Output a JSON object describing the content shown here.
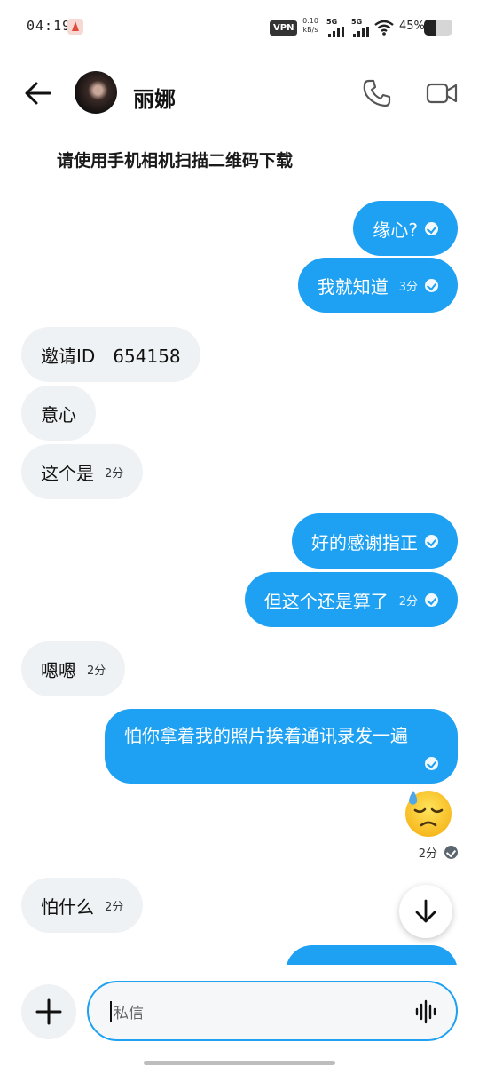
{
  "status_bar": {
    "time": "04:19",
    "vpn": "VPN",
    "speed_value": "0.10",
    "speed_unit": "kB/s",
    "signal1": "5G",
    "signal2": "5G",
    "battery": "45%"
  },
  "header": {
    "contact_name": "丽娜"
  },
  "banner": "请使用手机相机扫描二维码下载",
  "messages": [
    {
      "dir": "out",
      "text": "缘心?",
      "time": ""
    },
    {
      "dir": "out",
      "text": "我就知道",
      "time": "3分"
    },
    {
      "dir": "in",
      "text": "邀请ID　654158",
      "time": ""
    },
    {
      "dir": "in",
      "text": "意心",
      "time": ""
    },
    {
      "dir": "in",
      "text": "这个是",
      "time": "2分"
    },
    {
      "dir": "out",
      "text": "好的感谢指正",
      "time": ""
    },
    {
      "dir": "out",
      "text": "但这个还是算了",
      "time": "2分"
    },
    {
      "dir": "in",
      "text": "嗯嗯",
      "time": "2分"
    },
    {
      "dir": "out",
      "text": "怕你拿着我的照片挨着通讯录发一遍",
      "time": ""
    },
    {
      "dir": "out",
      "emoji": "downcast-face-with-sweat",
      "time": "2分"
    },
    {
      "dir": "in",
      "text": "怕什么",
      "time": "2分"
    }
  ],
  "composer": {
    "placeholder": "私信"
  },
  "colors": {
    "accent": "#1ea1f2",
    "incoming_bubble": "#eff2f4"
  }
}
